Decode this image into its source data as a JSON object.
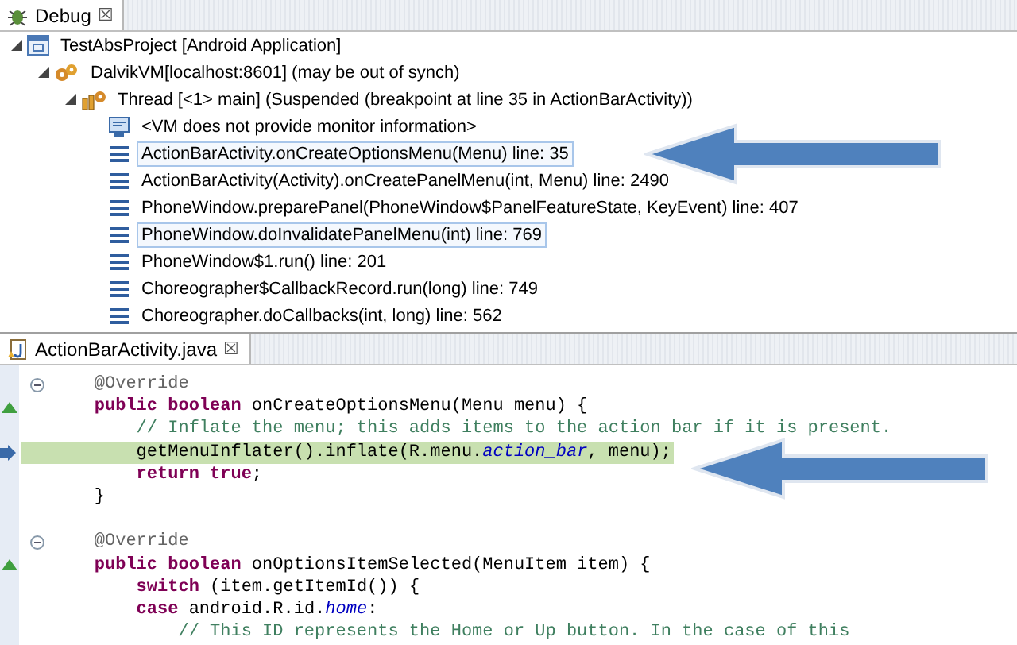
{
  "debug_view": {
    "tab": {
      "label": "Debug",
      "selected": true,
      "close": "☒"
    },
    "tree": [
      {
        "kind": "project",
        "label": "TestAbsProject [Android Application]",
        "expanded": true,
        "children": [
          {
            "kind": "vm",
            "label": "DalvikVM[localhost:8601] (may be out of synch)",
            "expanded": true,
            "children": [
              {
                "kind": "thread",
                "label": "Thread [<1> main] (Suspended (breakpoint at line 35 in ActionBarActivity))",
                "expanded": true,
                "children": [
                  {
                    "kind": "monitor",
                    "label": "<VM does not provide monitor information>",
                    "selected": false
                  },
                  {
                    "kind": "frame",
                    "label": "ActionBarActivity.onCreateOptionsMenu(Menu) line: 35",
                    "selected": true
                  },
                  {
                    "kind": "frame",
                    "label": "ActionBarActivity(Activity).onCreatePanelMenu(int, Menu) line: 2490",
                    "selected": false
                  },
                  {
                    "kind": "frame",
                    "label": "PhoneWindow.preparePanel(PhoneWindow$PanelFeatureState, KeyEvent) line: 407",
                    "selected": false
                  },
                  {
                    "kind": "frame",
                    "label": "PhoneWindow.doInvalidatePanelMenu(int) line: 769",
                    "selected": true
                  },
                  {
                    "kind": "frame",
                    "label": "PhoneWindow$1.run() line: 201",
                    "selected": false
                  },
                  {
                    "kind": "frame",
                    "label": "Choreographer$CallbackRecord.run(long) line: 749",
                    "selected": false
                  },
                  {
                    "kind": "frame",
                    "label": "Choreographer.doCallbacks(int, long) line: 562",
                    "selected": false
                  }
                ]
              }
            ]
          }
        ]
      }
    ]
  },
  "editor": {
    "tab": {
      "label": "ActionBarActivity.java",
      "selected": true,
      "close": "☒"
    },
    "lines": [
      {
        "fold": true,
        "override": false,
        "current": false,
        "parts": [
          {
            "kind": "annotation",
            "text": "    @Override"
          }
        ]
      },
      {
        "fold": false,
        "override": true,
        "current": false,
        "parts": [
          {
            "kind": "keyword",
            "text": "    public boolean "
          },
          {
            "kind": "plain",
            "text": "onCreateOptionsMenu(Menu menu) {"
          }
        ]
      },
      {
        "fold": false,
        "override": false,
        "current": false,
        "parts": [
          {
            "kind": "comment",
            "text": "        // Inflate the menu; this adds items to the action bar if it is present."
          }
        ]
      },
      {
        "fold": false,
        "override": false,
        "current": true,
        "parts": [
          {
            "kind": "plain",
            "text": "        getMenuInflater().inflate(R.menu."
          },
          {
            "kind": "field",
            "text": "action_bar"
          },
          {
            "kind": "plain",
            "text": ", menu);"
          }
        ]
      },
      {
        "fold": false,
        "override": false,
        "current": false,
        "parts": [
          {
            "kind": "keyword",
            "text": "        return true"
          },
          {
            "kind": "plain",
            "text": ";"
          }
        ]
      },
      {
        "fold": false,
        "override": false,
        "current": false,
        "parts": [
          {
            "kind": "plain",
            "text": "    }"
          }
        ]
      },
      {
        "fold": false,
        "override": false,
        "current": false
      },
      {
        "fold": true,
        "override": false,
        "current": false,
        "parts": [
          {
            "kind": "annotation",
            "text": "    @Override"
          }
        ]
      },
      {
        "fold": false,
        "override": true,
        "current": false,
        "parts": [
          {
            "kind": "keyword",
            "text": "    public boolean "
          },
          {
            "kind": "plain",
            "text": "onOptionsItemSelected(MenuItem item) {"
          }
        ]
      },
      {
        "fold": false,
        "override": false,
        "current": false,
        "parts": [
          {
            "kind": "keyword",
            "text": "        switch "
          },
          {
            "kind": "plain",
            "text": "(item.getItemId()) {"
          }
        ]
      },
      {
        "fold": false,
        "override": false,
        "current": false,
        "parts": [
          {
            "kind": "keyword",
            "text": "        case "
          },
          {
            "kind": "plain",
            "text": "android.R.id."
          },
          {
            "kind": "field",
            "text": "home"
          },
          {
            "kind": "plain",
            "text": ":"
          }
        ]
      },
      {
        "fold": false,
        "override": false,
        "current": false,
        "parts": [
          {
            "kind": "comment",
            "text": "            // This ID represents the Home or Up button. In the case of this"
          }
        ]
      }
    ]
  }
}
